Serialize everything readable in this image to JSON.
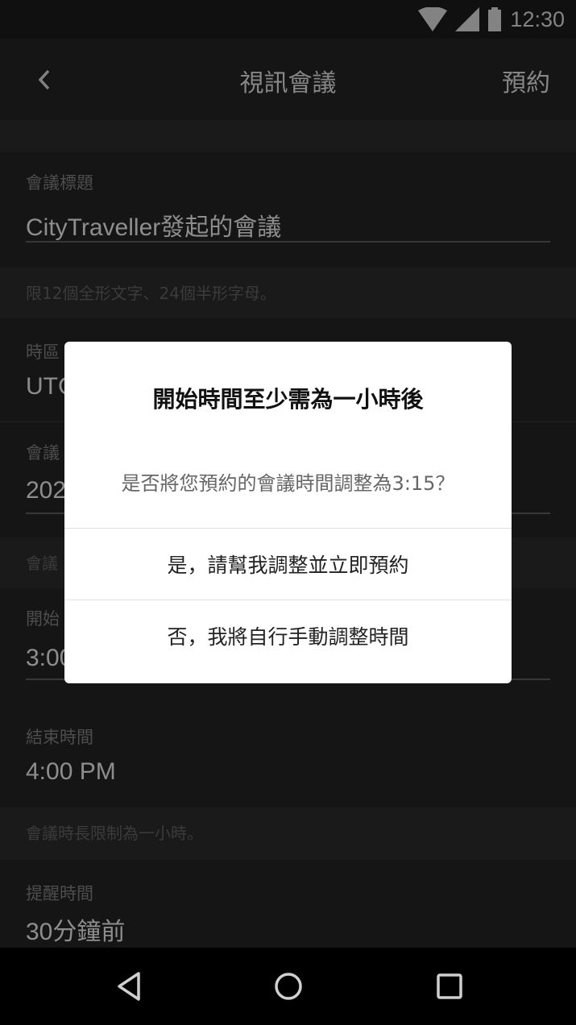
{
  "status_bar": {
    "time": "12:30"
  },
  "app_bar": {
    "title": "視訊會議",
    "action": "預約"
  },
  "form": {
    "meeting_title_label": "會議標題",
    "meeting_title_value": "CityTraveller發起的會議",
    "title_hint": "限12個全形文字、24個半形字母。",
    "timezone_label": "時區",
    "timezone_value": "UTC",
    "meeting_date_label": "會議",
    "meeting_date_value": "202",
    "section_label": "會議",
    "start_label": "開始",
    "start_value": "3:00",
    "end_label": "結束時間",
    "end_value": "4:00 PM",
    "duration_hint": "會議時長限制為一小時。",
    "reminder_label": "提醒時間",
    "reminder_value": "30分鐘前"
  },
  "dialog": {
    "title": "開始時間至少需為一小時後",
    "message": "是否將您預約的會議時間調整為3:15？",
    "confirm": "是，請幫我調整並立即預約",
    "cancel": "否，我將自行手動調整時間"
  },
  "colors": {
    "background": "#222222",
    "band": "#2b2b2b",
    "dialog": "#ffffff"
  }
}
